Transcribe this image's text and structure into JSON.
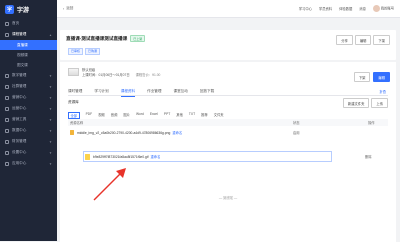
{
  "app": {
    "logo_text": "字游",
    "logo_mark": "字"
  },
  "sidebar": {
    "items": [
      {
        "label": "首页",
        "open": false
      },
      {
        "label": "课程管理",
        "open": true
      },
      {
        "label": "数字管理",
        "open": false
      },
      {
        "label": "社群管理",
        "open": false
      },
      {
        "label": "营销中心",
        "open": false
      },
      {
        "label": "运营中心",
        "open": false
      },
      {
        "label": "营销工具",
        "open": false
      },
      {
        "label": "数据中心",
        "open": false
      },
      {
        "label": "财务管理",
        "open": false
      },
      {
        "label": "设置中心",
        "open": false
      },
      {
        "label": "应用中心",
        "open": false
      }
    ],
    "sub_items": [
      {
        "label": "直播课",
        "active": true
      },
      {
        "label": "视频课",
        "active": false
      },
      {
        "label": "图文课",
        "active": false
      }
    ]
  },
  "topbar": {
    "back_label": "返回",
    "links": [
      "学习中心",
      "学员资料",
      "体验数据",
      "消息"
    ],
    "user_name": "我的账号"
  },
  "header": {
    "title": "直播课-测试直播课测试直播课",
    "status_badge": "已上架",
    "tags": [
      "已审核",
      "已购课"
    ],
    "share_label": "分享",
    "more_label": "编辑",
    "down_label": "下架"
  },
  "info": {
    "course_name": "默认班级",
    "time_label": "上课时间：01月06日～01月07日",
    "price_label": "课程售价：¥1.00",
    "btn_download": "下架",
    "btn_edit": "编辑"
  },
  "tabs": [
    "课时管理",
    "学习计划",
    "课程资料",
    "作业管理",
    "课堂互动",
    "回放下载"
  ],
  "active_tab": "课程资料",
  "fold_label": "折叠",
  "resources": {
    "title": "资源库",
    "new_folder_label": "新建文件夹",
    "upload_label": "上传",
    "filters": [
      "全部",
      "PDF",
      "视频",
      "音频",
      "图片",
      "Word",
      "Excel",
      "PPT",
      "其他",
      "TXT",
      "推荐",
      "文件夹"
    ],
    "active_filter": "全部",
    "columns": [
      "资源名称",
      "状态",
      "操作"
    ],
    "rows": [
      {
        "name": "middle_img_v2_c5a0b200-2790-4200-a4d9-47806986636g.png",
        "link": "重命名",
        "status": "启用",
        "action": "删除"
      },
      {
        "name": "b9e829ff7f873021fa5ac8f1571f6e0.gif",
        "link": "重命名",
        "status": "",
        "action": "删除"
      }
    ],
    "no_more": "— 到底啦 —"
  }
}
